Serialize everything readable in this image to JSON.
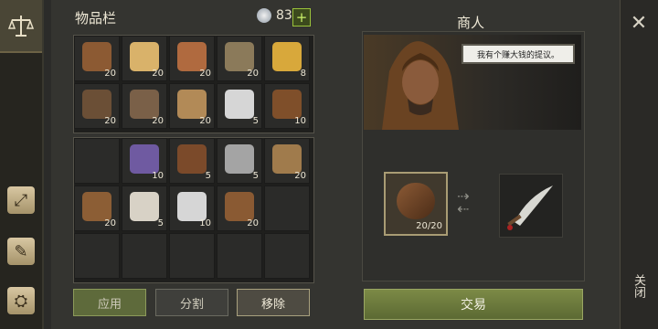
{
  "sidebar": {
    "items": [
      {
        "id": "scale",
        "icon": "scale-icon"
      },
      {
        "id": "map",
        "icon": "map-icon"
      },
      {
        "id": "scroll",
        "icon": "scroll-icon"
      },
      {
        "id": "backpack",
        "icon": "backpack-icon"
      }
    ]
  },
  "inventory": {
    "title": "物品栏",
    "currency": {
      "icon": "silver-coin-icon",
      "amount": "83",
      "add_label": "+"
    },
    "top_rows": [
      [
        {
          "icon": "claws-icon",
          "qty": "20"
        },
        {
          "icon": "candle-icon",
          "qty": "20"
        },
        {
          "icon": "copper-ingot-icon",
          "qty": "20"
        },
        {
          "icon": "chain-icon",
          "qty": "20"
        },
        {
          "icon": "gold-ring-icon",
          "qty": "8"
        }
      ],
      [
        {
          "icon": "rope-coil-icon",
          "qty": "20"
        },
        {
          "icon": "wood-plank-icon",
          "qty": "20"
        },
        {
          "icon": "cloth-roll-icon",
          "qty": "20"
        },
        {
          "icon": "mirror-icon",
          "qty": "5"
        },
        {
          "icon": "crossed-arrows-icon",
          "qty": "10"
        }
      ]
    ],
    "bottom_rows": [
      [
        {
          "icon": "",
          "qty": ""
        },
        {
          "icon": "net-icon",
          "qty": "10"
        },
        {
          "icon": "mug-icon",
          "qty": "5"
        },
        {
          "icon": "stone-block-icon",
          "qty": "5"
        },
        {
          "icon": "bead-string-icon",
          "qty": "20"
        }
      ],
      [
        {
          "icon": "leather-scroll-icon",
          "qty": "20"
        },
        {
          "icon": "skull-icon",
          "qty": "5"
        },
        {
          "icon": "salt-pile-icon",
          "qty": "10"
        },
        {
          "icon": "hide-icon",
          "qty": "20"
        },
        {
          "icon": "",
          "qty": ""
        }
      ],
      [
        {
          "icon": "",
          "qty": ""
        },
        {
          "icon": "",
          "qty": ""
        },
        {
          "icon": "",
          "qty": ""
        },
        {
          "icon": "",
          "qty": ""
        },
        {
          "icon": "",
          "qty": ""
        }
      ]
    ],
    "buttons": {
      "apply": "应用",
      "split": "分割",
      "remove": "移除"
    }
  },
  "merchant": {
    "title": "商人",
    "speech": "我有个赚大钱的提议。",
    "offer_item": {
      "icon": "leather-strap-icon",
      "qty": "20/20"
    },
    "receive_item": {
      "icon": "curved-sword-icon"
    },
    "trade_label": "交易"
  },
  "close": {
    "label": "关闭"
  },
  "colors": {
    "accent_green": "#7c8a46",
    "currency_plus": "#9ac23a"
  }
}
